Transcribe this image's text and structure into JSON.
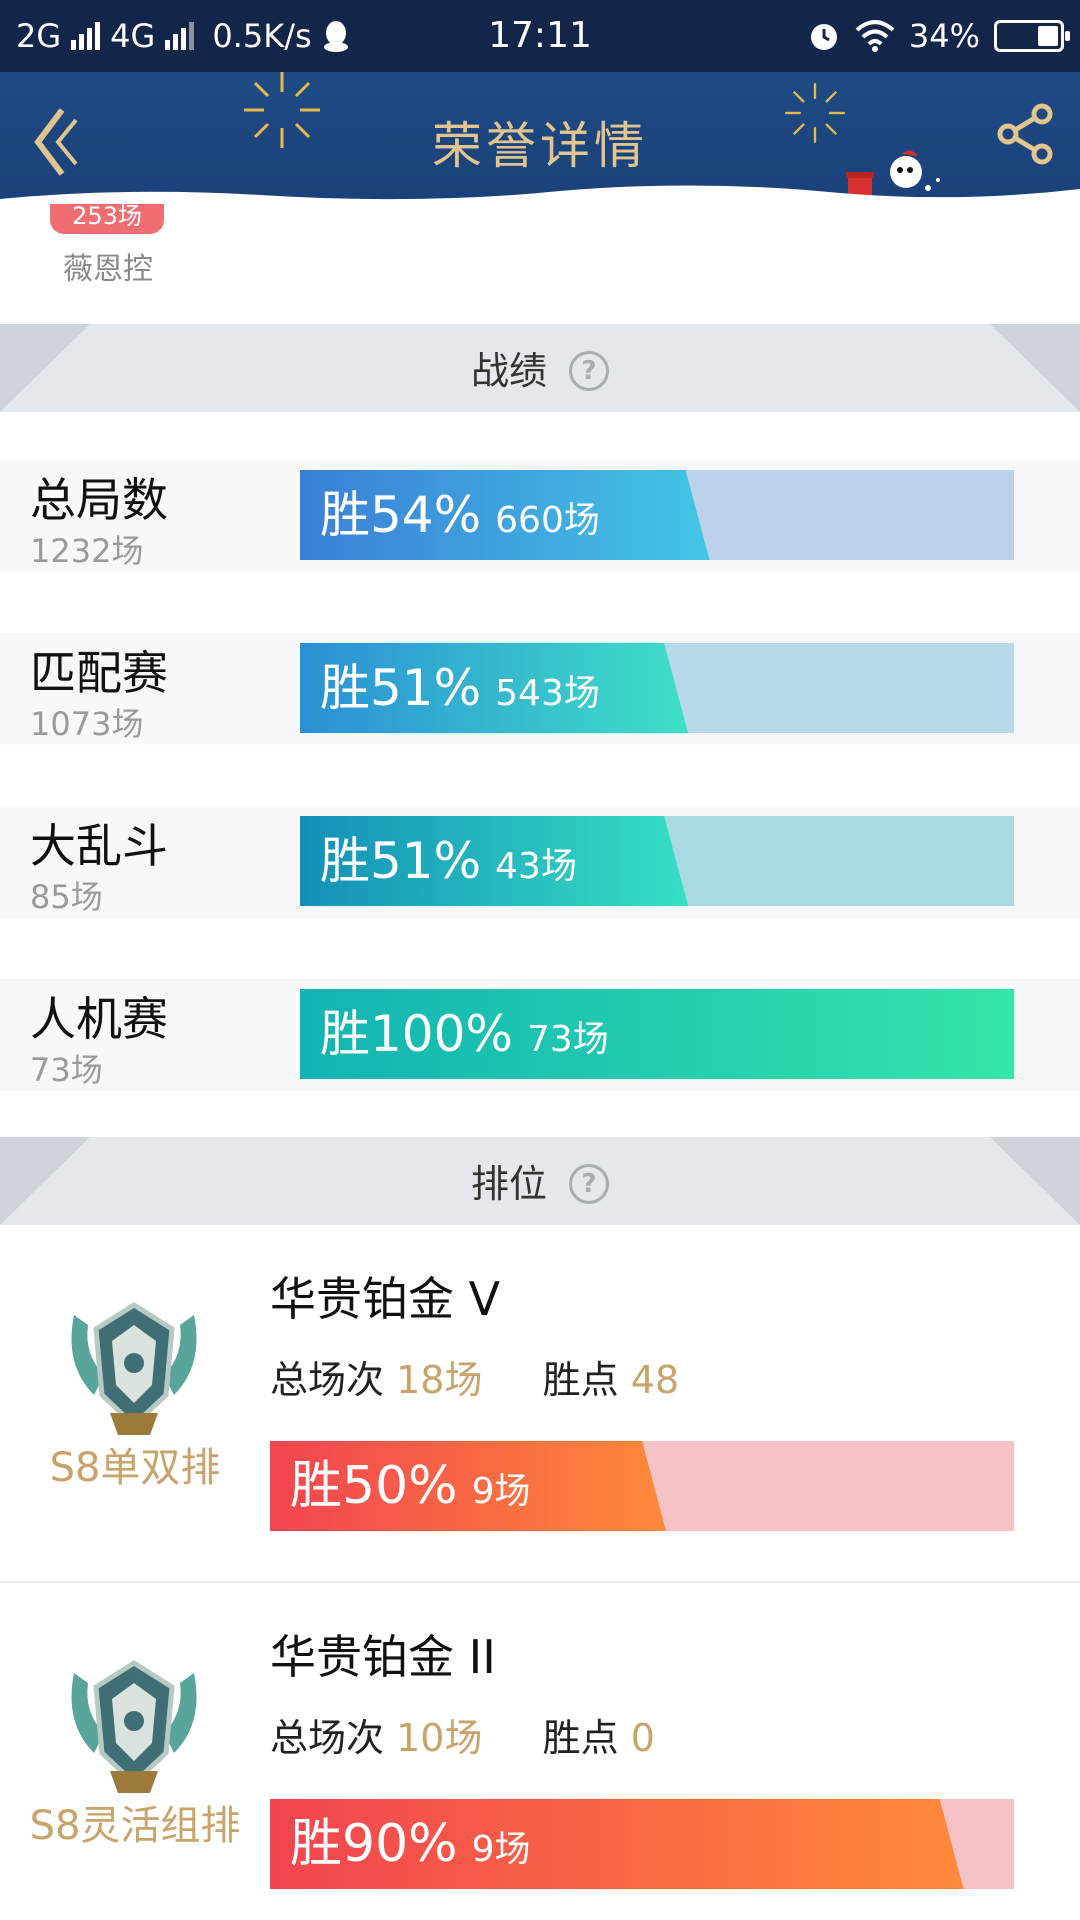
{
  "status_bar": {
    "network_1": "2G",
    "network_2": "4G",
    "speed": "0.5K/s",
    "time": "17:11",
    "battery": "34%",
    "battery_level": 0.34
  },
  "header": {
    "title": "荣誉详情",
    "back_icon": "chevron-left-icon",
    "share_icon": "share-icon"
  },
  "profile": {
    "count_badge": "253场",
    "nickname": "薇恩控"
  },
  "record_section": {
    "title": "战绩",
    "help_icon": "?"
  },
  "record_stats": [
    {
      "name": "总局数",
      "games": "1232场",
      "win_label": "胜54%",
      "win_games": "660场",
      "win_rate": 0.54,
      "color_start": "#3a7fd6",
      "color_end": "#43c6e6",
      "track": "#bcd1ea"
    },
    {
      "name": "匹配赛",
      "games": "1073场",
      "win_label": "胜51%",
      "win_games": "543场",
      "win_rate": 0.51,
      "color_start": "#2b8fd6",
      "color_end": "#3fe0c6",
      "track": "#b8d8ec"
    },
    {
      "name": "大乱斗",
      "games": "85场",
      "win_label": "胜51%",
      "win_games": "43场",
      "win_rate": 0.51,
      "color_start": "#138fb8",
      "color_end": "#37e0c4",
      "track": "#a9d9e2"
    },
    {
      "name": "人机赛",
      "games": "73场",
      "win_label": "胜100%",
      "win_games": "73场",
      "win_rate": 1.0,
      "color_start": "#12b3b3",
      "color_end": "#33e6aa",
      "track": "#a9e3d6"
    }
  ],
  "rank_section": {
    "title": "排位",
    "help_icon": "?"
  },
  "rank_cards": [
    {
      "mode": "S8单双排",
      "tier": "华贵铂金 V",
      "total_label": "总场次",
      "total_value": "18场",
      "points_label": "胜点",
      "points_value": "48",
      "win_label": "胜50%",
      "win_games": "9场",
      "win_rate": 0.5,
      "emblem_icon": "platinum-emblem-icon"
    },
    {
      "mode": "S8灵活组排",
      "tier": "华贵铂金 II",
      "total_label": "总场次",
      "total_value": "10场",
      "points_label": "胜点",
      "points_value": "0",
      "win_label": "胜90%",
      "win_games": "9场",
      "win_rate": 0.9,
      "emblem_icon": "platinum-emblem-icon"
    }
  ],
  "colors": {
    "header_bg": "#1f4b84",
    "title_gold": "#e1c48e",
    "accent_gold": "#c8a36a",
    "rank_fill_start": "#f2444f",
    "rank_fill_end": "#ff8a3a",
    "rank_track": "#f6c2c6"
  }
}
